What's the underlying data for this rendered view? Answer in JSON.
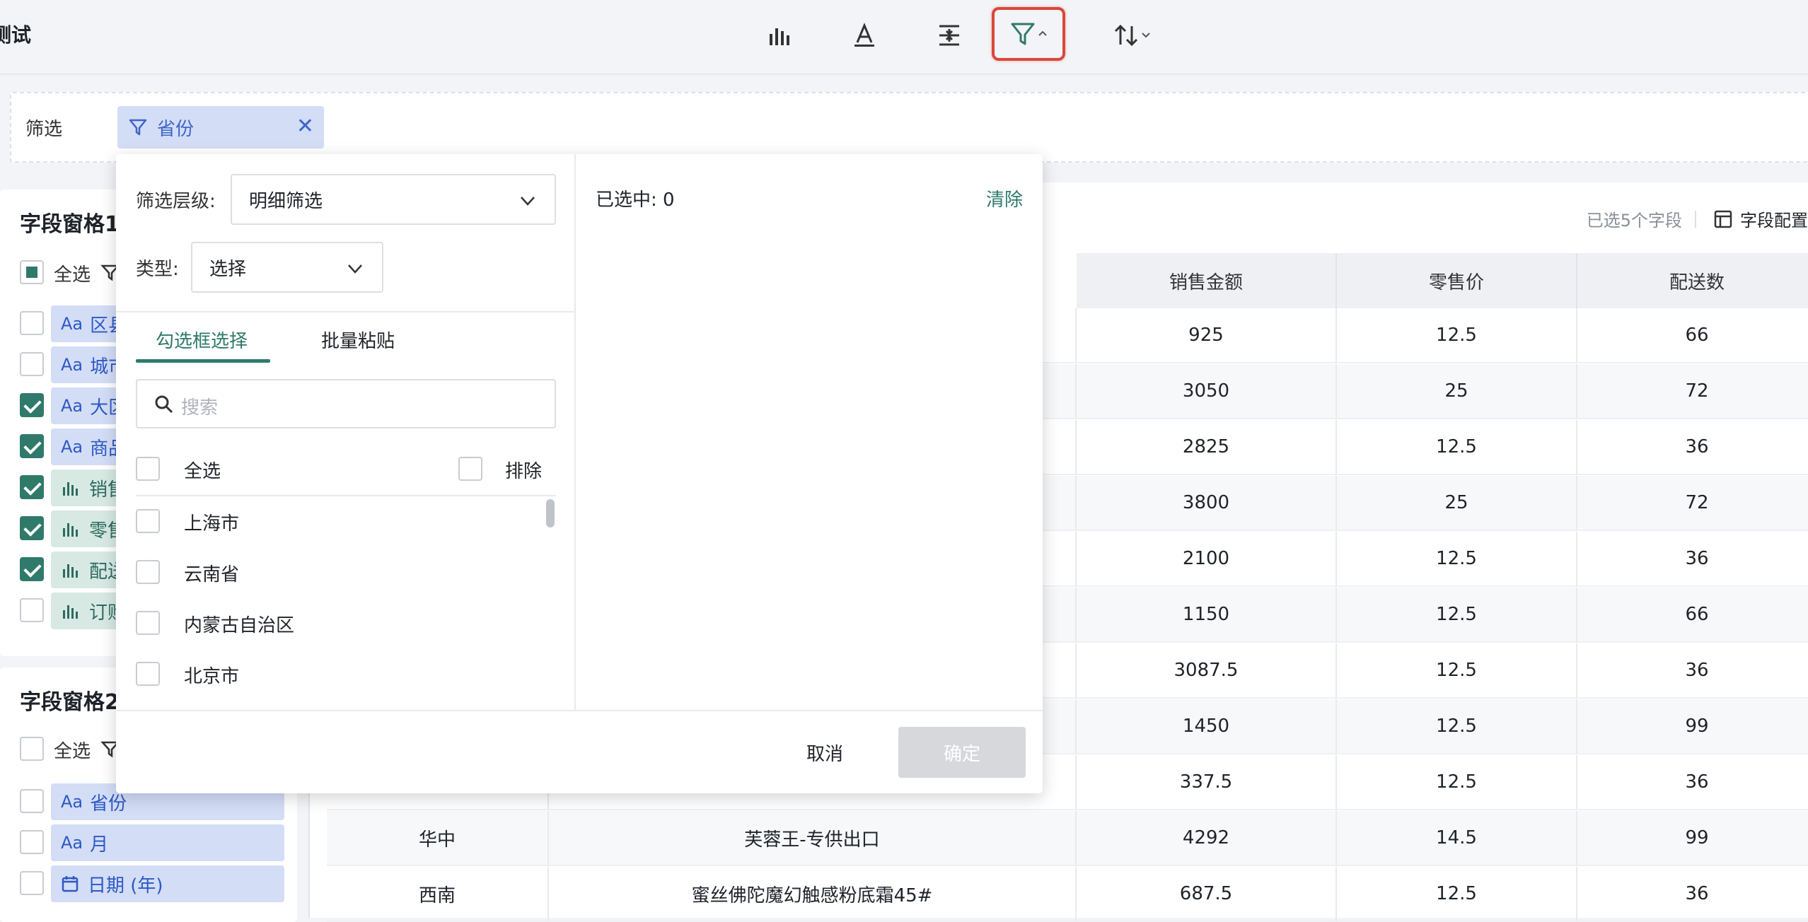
{
  "app": {
    "title": "测试"
  },
  "filter_strip": {
    "label": "筛选",
    "chip_label": "省份"
  },
  "field_pane_1": {
    "title": "字段窗格1",
    "select_all": "全选",
    "fields": [
      {
        "type": "Aa",
        "name": "区县",
        "checked": false
      },
      {
        "type": "Aa",
        "name": "城市",
        "checked": false
      },
      {
        "type": "Aa",
        "name": "大区",
        "checked": true
      },
      {
        "type": "Aa",
        "name": "商品",
        "checked": true
      },
      {
        "type": "bar",
        "name": "销售",
        "checked": true
      },
      {
        "type": "bar",
        "name": "零售",
        "checked": true
      },
      {
        "type": "bar",
        "name": "配送",
        "checked": true
      },
      {
        "type": "bar",
        "name": "订购",
        "checked": false
      }
    ]
  },
  "field_pane_2": {
    "title": "字段窗格2",
    "select_all": "全选",
    "fields": [
      {
        "type": "Aa",
        "name": "省份"
      },
      {
        "type": "Aa",
        "name": "月"
      },
      {
        "type": "cal",
        "name": "日期 (年)"
      }
    ]
  },
  "table": {
    "meta_selected": "已选5个字段",
    "meta_config": "字段配置",
    "headers": [
      "销售金额",
      "零售价",
      "配送数"
    ],
    "rows": [
      {
        "region": "",
        "product": "",
        "sales": "925",
        "price": "12.5",
        "qty": "66"
      },
      {
        "region": "",
        "product": "",
        "sales": "3050",
        "price": "25",
        "qty": "72"
      },
      {
        "region": "",
        "product": "",
        "sales": "2825",
        "price": "12.5",
        "qty": "36"
      },
      {
        "region": "",
        "product": "",
        "sales": "3800",
        "price": "25",
        "qty": "72"
      },
      {
        "region": "",
        "product": "",
        "sales": "2100",
        "price": "12.5",
        "qty": "36"
      },
      {
        "region": "",
        "product": "",
        "sales": "1150",
        "price": "12.5",
        "qty": "66"
      },
      {
        "region": "",
        "product": "",
        "sales": "3087.5",
        "price": "12.5",
        "qty": "36"
      },
      {
        "region": "",
        "product": "",
        "sales": "1450",
        "price": "12.5",
        "qty": "99"
      },
      {
        "region": "",
        "product": "",
        "sales": "337.5",
        "price": "12.5",
        "qty": "36"
      },
      {
        "region": "华中",
        "product": "芙蓉王-专供出口",
        "sales": "4292",
        "price": "14.5",
        "qty": "99"
      },
      {
        "region": "西南",
        "product": "蜜丝佛陀魔幻触感粉底霜45#",
        "sales": "687.5",
        "price": "12.5",
        "qty": "36"
      }
    ]
  },
  "popup": {
    "level_label": "筛选层级:",
    "level_value": "明细筛选",
    "type_label": "类型:",
    "type_value": "选择",
    "tabs": [
      "勾选框选择",
      "批量粘贴"
    ],
    "search_placeholder": "搜索",
    "select_all": "全选",
    "exclude": "排除",
    "options": [
      "上海市",
      "云南省",
      "内蒙古自治区",
      "北京市"
    ],
    "selected_count": "已选中: 0",
    "clear": "清除",
    "cancel": "取消",
    "ok": "确定"
  },
  "colors": {
    "accent": "#2f7a6a",
    "highlight": "#d9483a",
    "dim_field": "#d3ddf6",
    "measure_field": "#d8e9e4"
  }
}
